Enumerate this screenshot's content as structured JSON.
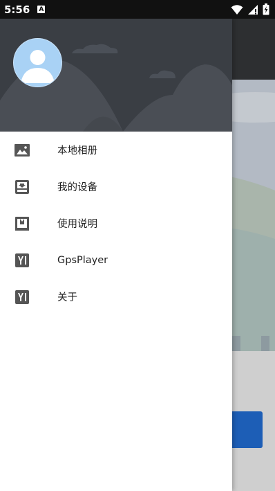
{
  "status_bar": {
    "time": "5:56",
    "notification_icon": "A",
    "icons": [
      "wifi-icon",
      "signal-icon",
      "battery-charging-icon"
    ]
  },
  "drawer": {
    "header": {
      "avatar_icon": "avatar-placeholder-icon"
    },
    "menu": [
      {
        "label": "本地相册",
        "icon": "image-icon"
      },
      {
        "label": "我的设备",
        "icon": "download-box-icon"
      },
      {
        "label": "使用说明",
        "icon": "manual-icon"
      },
      {
        "label": "GpsPlayer",
        "icon": "yi-logo-icon"
      },
      {
        "label": "关于",
        "icon": "yi-logo-icon"
      }
    ]
  },
  "colors": {
    "drawer_header_bg": "#3a3e44",
    "status_bar_bg": "#111111",
    "accent_button": "#1d5eb6"
  }
}
